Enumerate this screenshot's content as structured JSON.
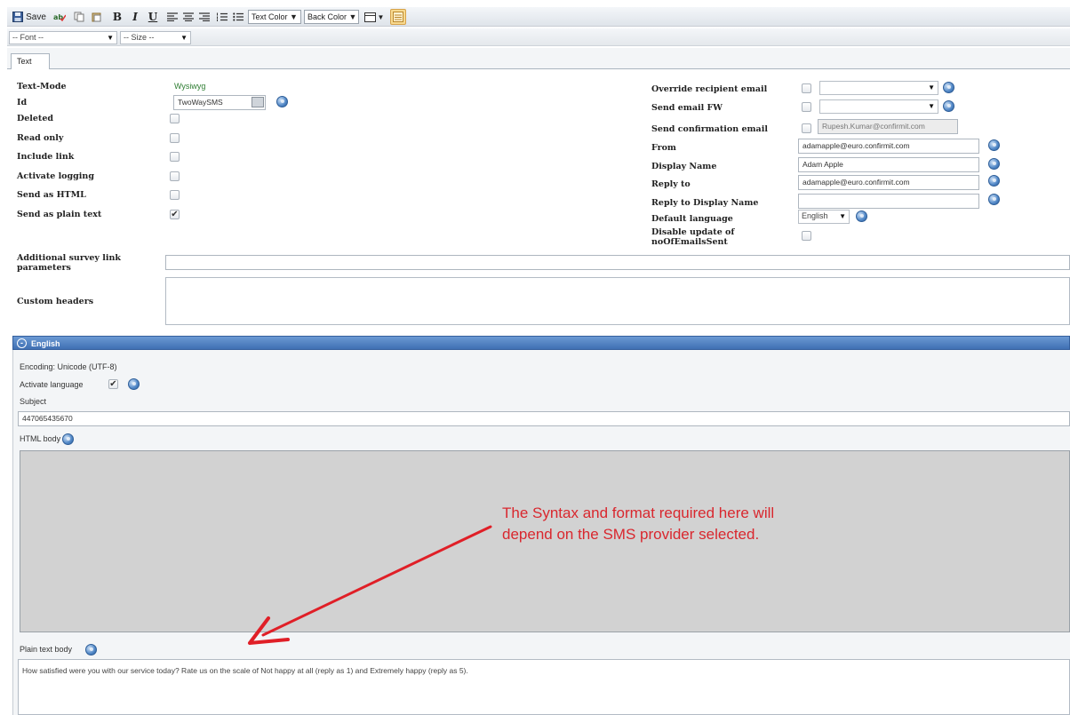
{
  "toolbar": {
    "save_label": "Save",
    "text_color_label": "Text Color",
    "back_color_label": "Back Color",
    "font_placeholder": "-- Font --",
    "size_placeholder": "-- Size --",
    "bold_label": "B",
    "italic_label": "I",
    "underline_label": "U"
  },
  "tabs": [
    {
      "label": "Text"
    }
  ],
  "left_fields": {
    "text_mode_label": "Text-Mode",
    "text_mode_value": "Wysiwyg",
    "id_label": "Id",
    "id_value": "TwoWaySMS",
    "deleted_label": "Deleted",
    "read_only_label": "Read only",
    "include_link_label": "Include link",
    "activate_logging_label": "Activate logging",
    "send_as_html_label": "Send as HTML",
    "send_plain_label": "Send as plain text",
    "check_mark": "✔"
  },
  "right_fields": {
    "override_label": "Override recipient email",
    "send_fw_label": "Send email FW",
    "confirmation_label": "Send confirmation email",
    "confirmation_value": "Rupesh.Kumar@confirmit.com",
    "from_label": "From",
    "from_value": "adamapple@euro.confirmit.com",
    "display_name_label": "Display Name",
    "display_name_value": "Adam Apple",
    "reply_to_label": "Reply to",
    "reply_to_value": "adamapple@euro.confirmit.com",
    "reply_display_label": "Reply to Display Name",
    "default_language_label": "Default language",
    "default_language_value": "English",
    "disable_update_label_1": "Disable update of",
    "disable_update_label_2": "noOfEmailsSent"
  },
  "extra": {
    "survey_params_label_1": "Additional survey link",
    "survey_params_label_2": "parameters",
    "custom_headers_label": "Custom headers"
  },
  "language_panel": {
    "title": "English",
    "encoding": "Encoding: Unicode (UTF-8)",
    "activate_label": "Activate language",
    "subject_label": "Subject",
    "subject_value": "447065435670",
    "html_body_label": "HTML body",
    "plain_body_label": "Plain text body",
    "plain_body_value": "How satisfied were you with our service today? Rate us on the scale of Not happy at all (reply as 1) and Extremely happy (reply as 5)."
  },
  "annotation": {
    "line1": "The Syntax and format required here will",
    "line2": "depend on the SMS provider selected.",
    "color": "#d9272e"
  }
}
